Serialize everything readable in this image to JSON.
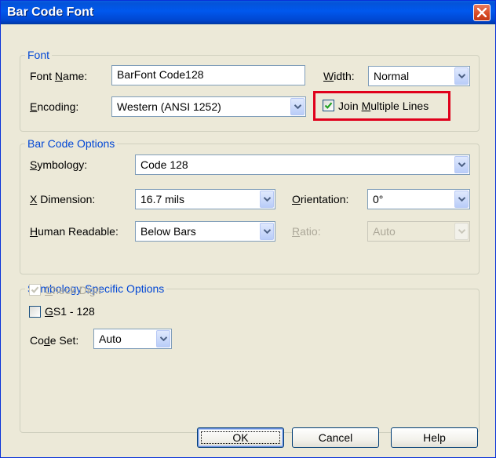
{
  "window": {
    "title": "Bar Code Font"
  },
  "font_group": {
    "legend": "Font",
    "font_name_label_prefix": "Font ",
    "font_name_label_accel": "N",
    "font_name_label_suffix": "ame:",
    "font_name_value": "BarFont Code128",
    "width_label_accel": "W",
    "width_label_suffix": "idth:",
    "width_value": "Normal",
    "encoding_label_accel": "E",
    "encoding_label_suffix": "ncoding:",
    "encoding_value": "Western (ANSI 1252)",
    "join_label_prefix": "Join ",
    "join_label_accel": "M",
    "join_label_suffix": "ultiple Lines",
    "join_checked": true
  },
  "barcode_group": {
    "legend": "Bar Code Options",
    "symbology_label_accel": "S",
    "symbology_label_suffix": "ymbology:",
    "symbology_value": "Code 128",
    "xdim_label_accel": "X",
    "xdim_label_suffix": " Dimension:",
    "xdim_value": "16.7 mils",
    "orientation_label_accel": "O",
    "orientation_label_suffix": "rientation:",
    "orientation_value": "0°",
    "human_label_accel": "H",
    "human_label_suffix": "uman Readable:",
    "human_value": "Below Bars",
    "ratio_label_accel": "R",
    "ratio_label_suffix": "atio:",
    "ratio_value": "Auto"
  },
  "symbology_group": {
    "legend": "Symbology Specific Options",
    "check_digit_accel": "C",
    "check_digit_suffix": "heck Digit",
    "check_digit_checked": true,
    "gs1_accel": "G",
    "gs1_suffix": "S1 - 128",
    "gs1_checked": false,
    "codeset_label_prefix": "Co",
    "codeset_label_accel": "d",
    "codeset_label_suffix": "e Set:",
    "codeset_value": "Auto"
  },
  "buttons": {
    "ok": "OK",
    "cancel": "Cancel",
    "help": "Help"
  }
}
